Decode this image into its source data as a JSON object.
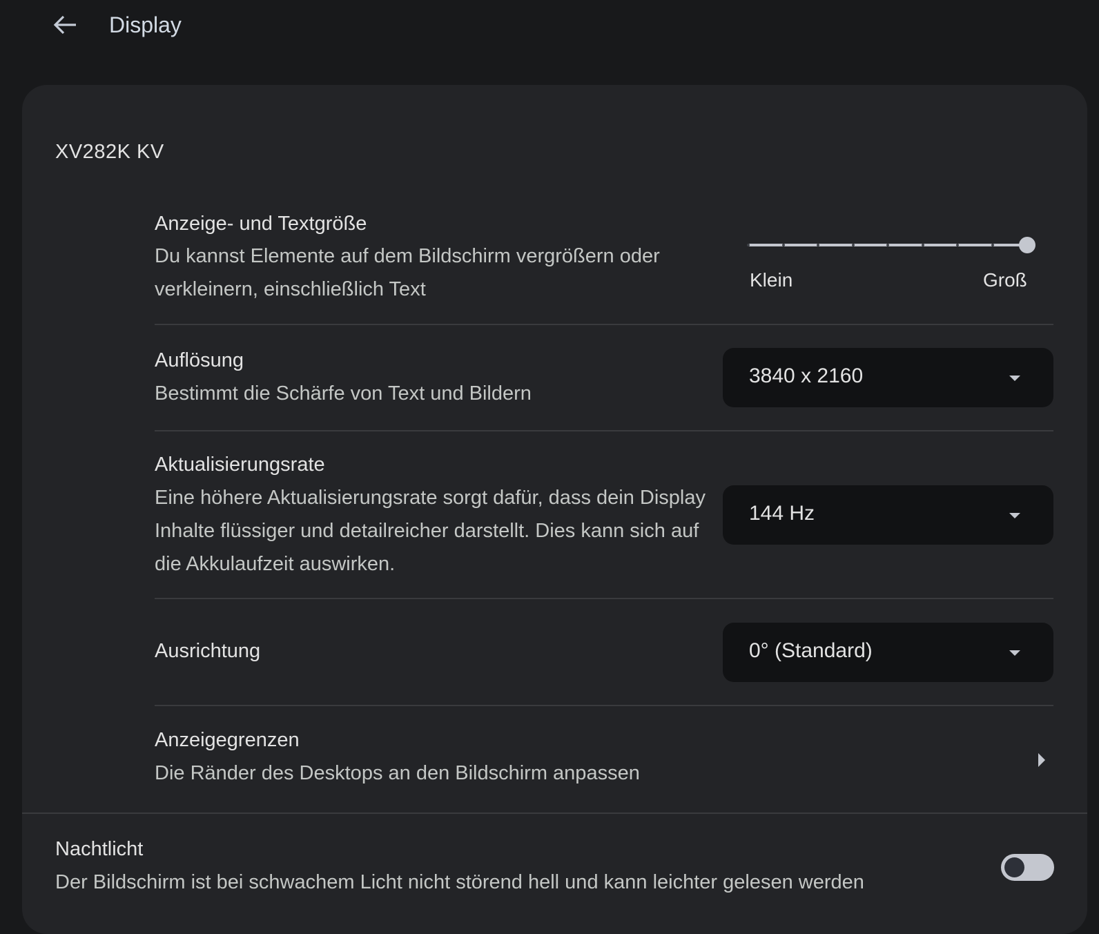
{
  "header": {
    "title": "Display"
  },
  "monitor": {
    "name": "XV282K KV"
  },
  "size": {
    "label": "Anzeige- und Textgröße",
    "desc": "Du kannst Elemente auf dem Bildschirm vergrößern oder verkleinern, einschließlich Text",
    "min_label": "Klein",
    "max_label": "Groß",
    "steps": 9,
    "value_fraction": 1.0
  },
  "resolution": {
    "label": "Auflösung",
    "desc": "Bestimmt die Schärfe von Text und Bildern",
    "value": "3840 x 2160"
  },
  "refresh": {
    "label": "Aktualisierungsrate",
    "desc": "Eine höhere Aktualisierungsrate sorgt dafür, dass dein Display Inhalte flüssiger und detailreicher darstellt. Dies kann sich auf die Akkulaufzeit auswirken.",
    "value": "144 Hz"
  },
  "orientation": {
    "label": "Ausrichtung",
    "value": "0° (Standard)"
  },
  "overscan": {
    "label": "Anzeigegrenzen",
    "desc": "Die Ränder des Desktops an den Bildschirm anpassen"
  },
  "nightlight": {
    "label": "Nachtlicht",
    "desc": "Der Bildschirm ist bei schwachem Licht nicht störend hell und kann leichter gelesen werden",
    "enabled": false
  },
  "colors": {
    "accent": "#c4c7cf",
    "card": "#232427",
    "bg": "#18191b"
  }
}
